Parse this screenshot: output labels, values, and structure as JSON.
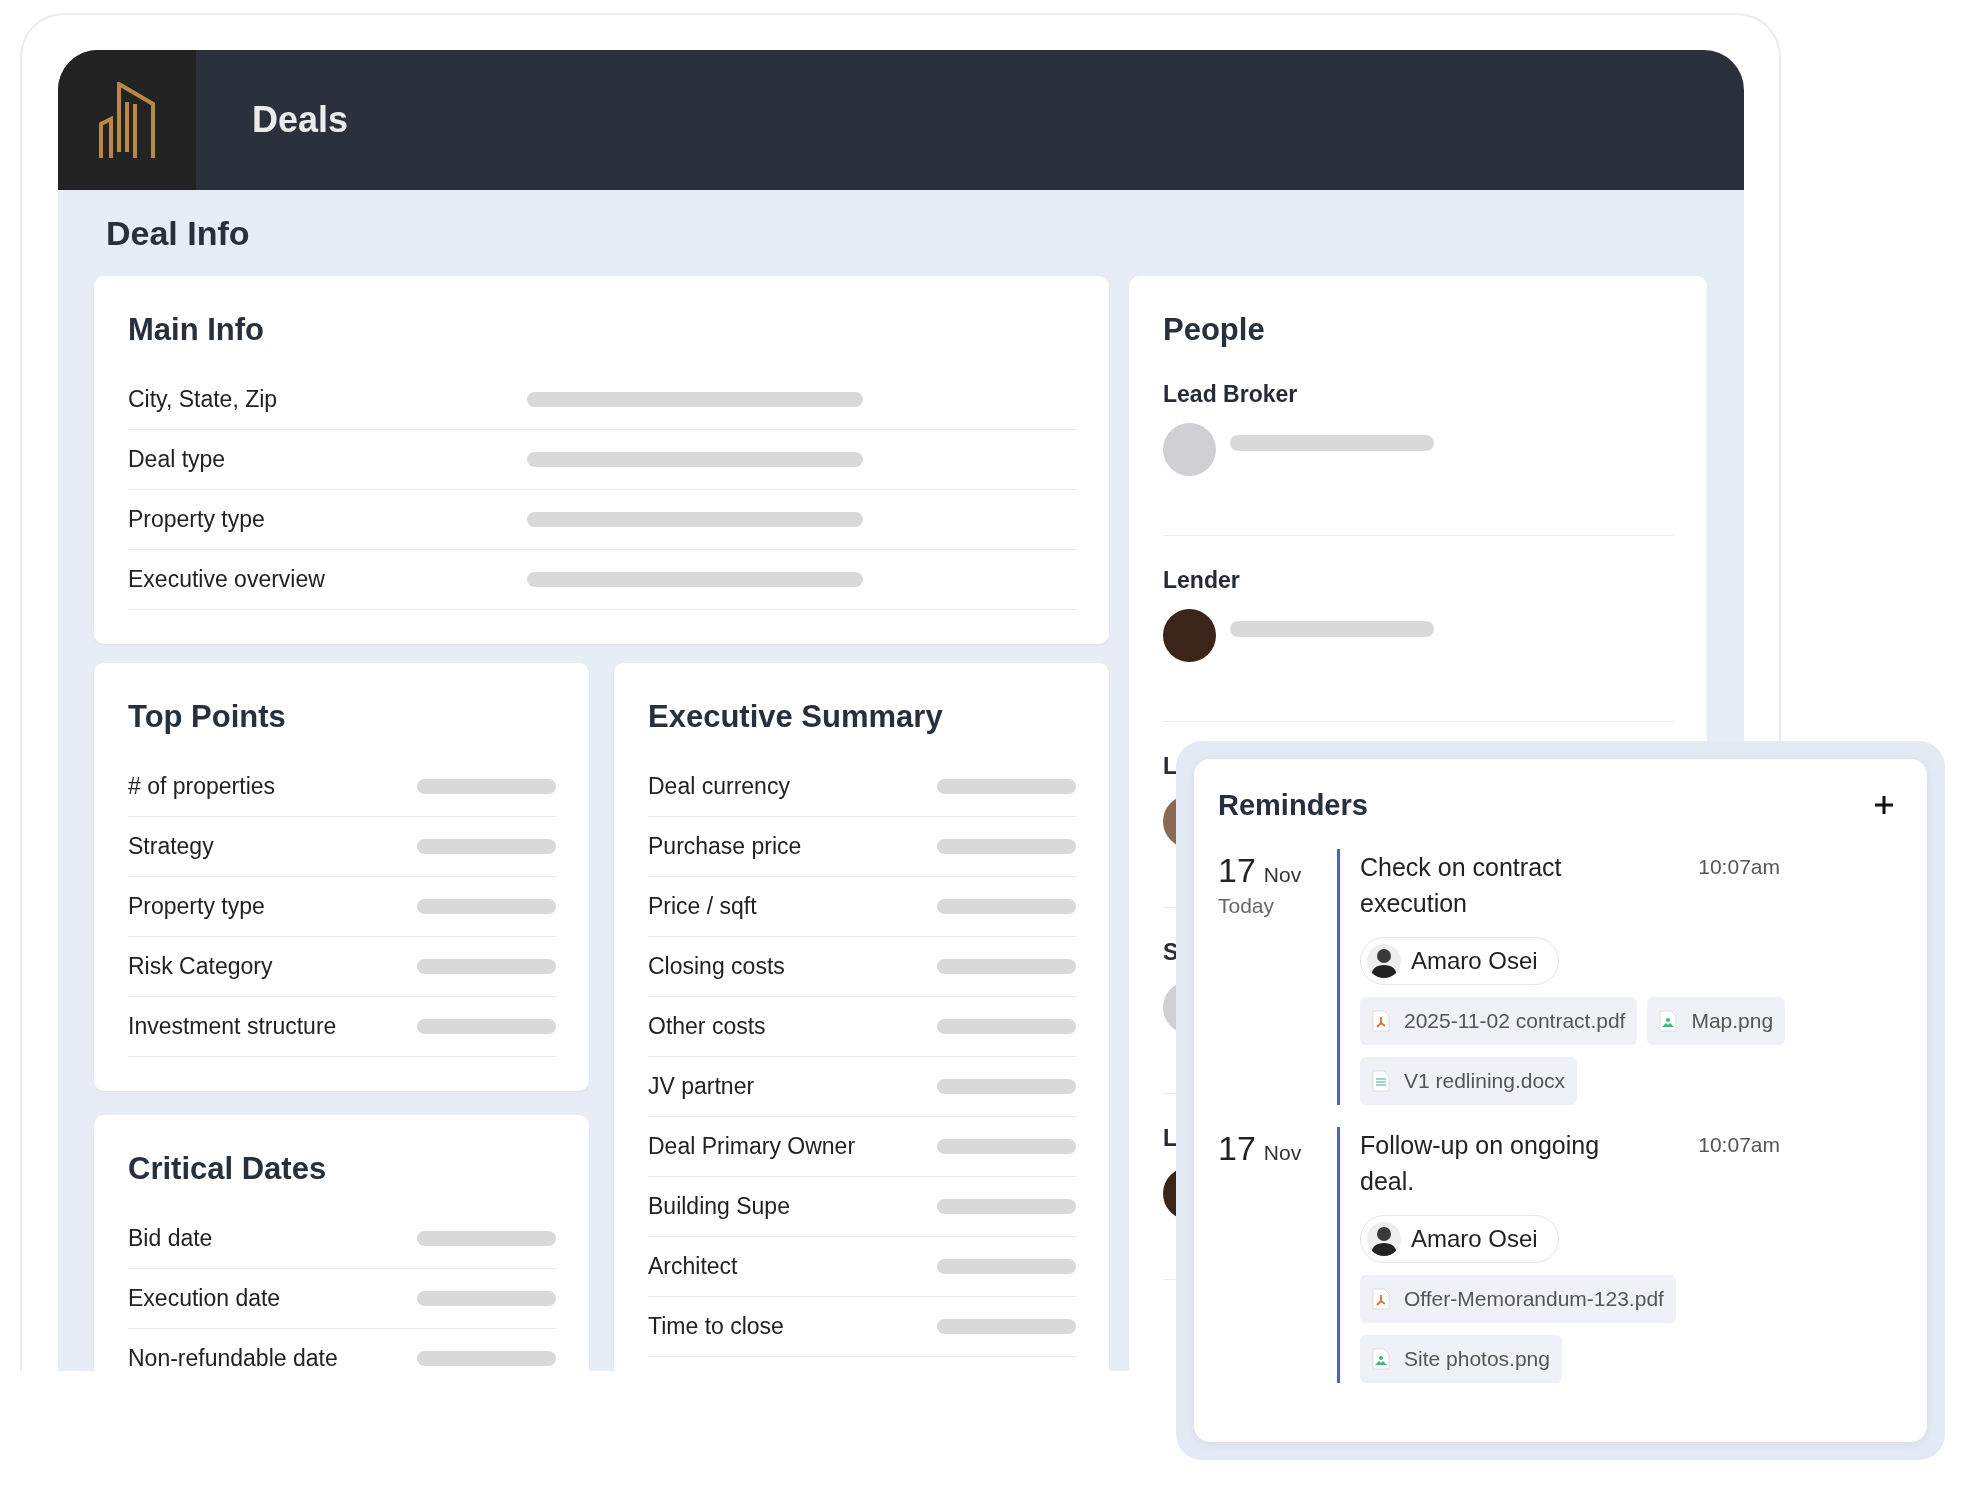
{
  "header": {
    "title": "Deals"
  },
  "page_title": "Deal Info",
  "main_info": {
    "title": "Main Info",
    "fields": [
      "City, State, Zip",
      "Deal type",
      "Property type",
      "Executive overview"
    ]
  },
  "top_points": {
    "title": "Top Points",
    "fields": [
      "# of properties",
      "Strategy",
      "Property type",
      "Risk Category",
      "Investment structure"
    ]
  },
  "critical_dates": {
    "title": "Critical Dates",
    "fields": [
      "Bid date",
      "Execution date",
      "Non-refundable date"
    ]
  },
  "executive_summary": {
    "title": "Executive Summary",
    "fields": [
      "Deal currency",
      "Purchase price",
      "Price / sqft",
      "Closing costs",
      "Other costs",
      "JV partner",
      "Deal Primary Owner",
      "Building Supe",
      "Architect",
      "Time to close"
    ]
  },
  "people": {
    "title": "People",
    "roles": [
      "Lead Broker",
      "Lender",
      "L",
      "S",
      "L"
    ]
  },
  "reminders": {
    "title": "Reminders",
    "items": [
      {
        "day": "17",
        "month": "Nov",
        "relative": "Today",
        "text": "Check on contract execution",
        "time": "10:07am",
        "assignee": "Amaro Osei",
        "attachments": [
          {
            "name": "2025-11-02 contract.pdf",
            "kind": "pdf"
          },
          {
            "name": "Map.png",
            "kind": "image"
          },
          {
            "name": "V1 redlining.docx",
            "kind": "doc"
          }
        ]
      },
      {
        "day": "17",
        "month": "Nov",
        "text": "Follow-up on ongoing deal.",
        "time": "10:07am",
        "assignee": "Amaro Osei",
        "attachments": [
          {
            "name": "Offer-Memorandum-123.pdf",
            "kind": "pdf"
          },
          {
            "name": "Site photos.png",
            "kind": "image"
          }
        ]
      }
    ]
  }
}
